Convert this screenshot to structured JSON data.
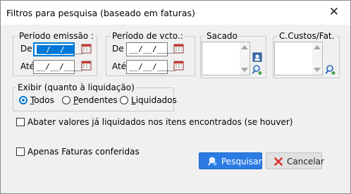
{
  "dialog": {
    "title": "Filtros para pesquisa (baseado em faturas)",
    "close_glyph": "✕"
  },
  "emissao": {
    "legend": "Período emissão :",
    "de_label": "De",
    "ate_label": "Até",
    "de_value_sel": "__/__/__",
    "de_value_rest": "__",
    "ate_value": "__/__/____"
  },
  "vcto": {
    "legend": "Período de vcto.:",
    "de_label": "De",
    "ate_label": "Até",
    "de_value": "__/__/____",
    "ate_value": "__/__/____"
  },
  "sacado": {
    "legend": "Sacado"
  },
  "ccustos": {
    "legend": "C.Custos/Fat."
  },
  "exibir": {
    "legend": "Exibir (quanto à liquidação)",
    "options": [
      {
        "first": "T",
        "rest": "odos",
        "selected": true
      },
      {
        "first": "P",
        "rest": "endentes",
        "selected": false
      },
      {
        "first": "L",
        "rest": "iquidados",
        "selected": false
      }
    ]
  },
  "abater": {
    "label": "Abater valores já liquidados nos itens encontrados (se houver)",
    "checked": false
  },
  "conferidas": {
    "label": "Apenas Faturas conferidas",
    "checked": false
  },
  "buttons": {
    "pesquisar": "Pesquisar",
    "cancelar": "Cancelar"
  },
  "colors": {
    "accent": "#0078d7",
    "primary_button": "#2c7be5",
    "cancel_x": "#d9342b"
  },
  "icons": [
    "calendar-icon",
    "search-user-icon",
    "search-add-icon",
    "magnifier-icon",
    "close-x-icon"
  ]
}
